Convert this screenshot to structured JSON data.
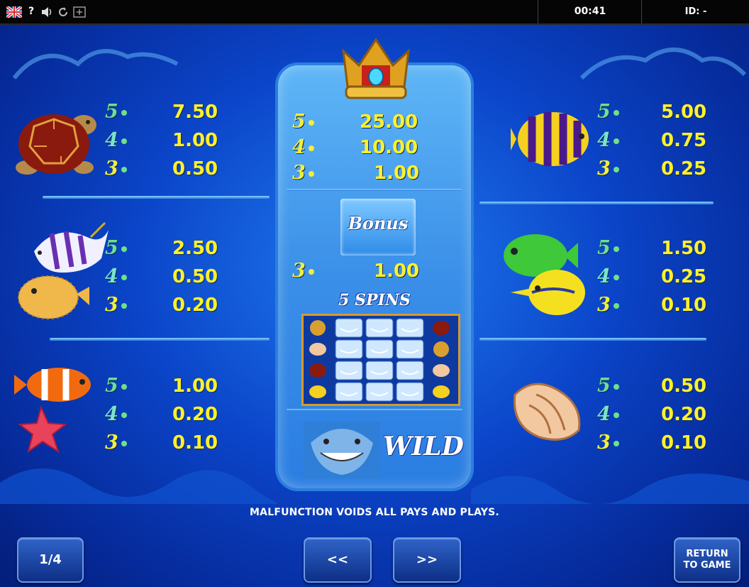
{
  "topbar": {
    "icons": [
      "uk-flag-icon",
      "help-icon",
      "sound-icon",
      "refresh-icon",
      "fullscreen-icon"
    ],
    "help_label": "?",
    "clock": "00:41",
    "id_label": "ID: -"
  },
  "paytable": {
    "left": [
      {
        "symbol": "turtle",
        "pays": [
          {
            "count": "5",
            "value": "7.50"
          },
          {
            "count": "4",
            "value": "1.00"
          },
          {
            "count": "3",
            "value": "0.50"
          }
        ]
      },
      {
        "symbol": "angelfish-and-pufferfish",
        "pays": [
          {
            "count": "5",
            "value": "2.50"
          },
          {
            "count": "4",
            "value": "0.50"
          },
          {
            "count": "3",
            "value": "0.20"
          }
        ]
      },
      {
        "symbol": "clownfish-and-starfish",
        "pays": [
          {
            "count": "5",
            "value": "1.00"
          },
          {
            "count": "4",
            "value": "0.20"
          },
          {
            "count": "3",
            "value": "0.10"
          }
        ]
      }
    ],
    "right": [
      {
        "symbol": "striped-fish",
        "pays": [
          {
            "count": "5",
            "value": "5.00"
          },
          {
            "count": "4",
            "value": "0.75"
          },
          {
            "count": "3",
            "value": "0.25"
          }
        ]
      },
      {
        "symbol": "green-and-yellow-fish",
        "pays": [
          {
            "count": "5",
            "value": "1.50"
          },
          {
            "count": "4",
            "value": "0.25"
          },
          {
            "count": "3",
            "value": "0.10"
          }
        ]
      },
      {
        "symbol": "seashell",
        "pays": [
          {
            "count": "5",
            "value": "0.50"
          },
          {
            "count": "4",
            "value": "0.20"
          },
          {
            "count": "3",
            "value": "0.10"
          }
        ]
      }
    ],
    "center": {
      "symbol": "crown",
      "pays": [
        {
          "count": "5",
          "value": "25.00"
        },
        {
          "count": "4",
          "value": "10.00"
        },
        {
          "count": "3",
          "value": "1.00"
        }
      ],
      "bonus_label": "Bonus",
      "bonus_pay": {
        "count": "3",
        "value": "1.00"
      },
      "spins_label": "5 SPINS",
      "wild_label": "WILD"
    }
  },
  "disclaimer": "MALFUNCTION VOIDS ALL PAYS AND PLAYS.",
  "nav": {
    "page": "1/4",
    "prev": "<<",
    "next": ">>",
    "return_line1": "RETURN",
    "return_line2": "TO GAME"
  },
  "colors": {
    "value_yellow": "#fff12a",
    "count_green": "#6fe08a",
    "panel_blue": "#1f7bf0"
  }
}
